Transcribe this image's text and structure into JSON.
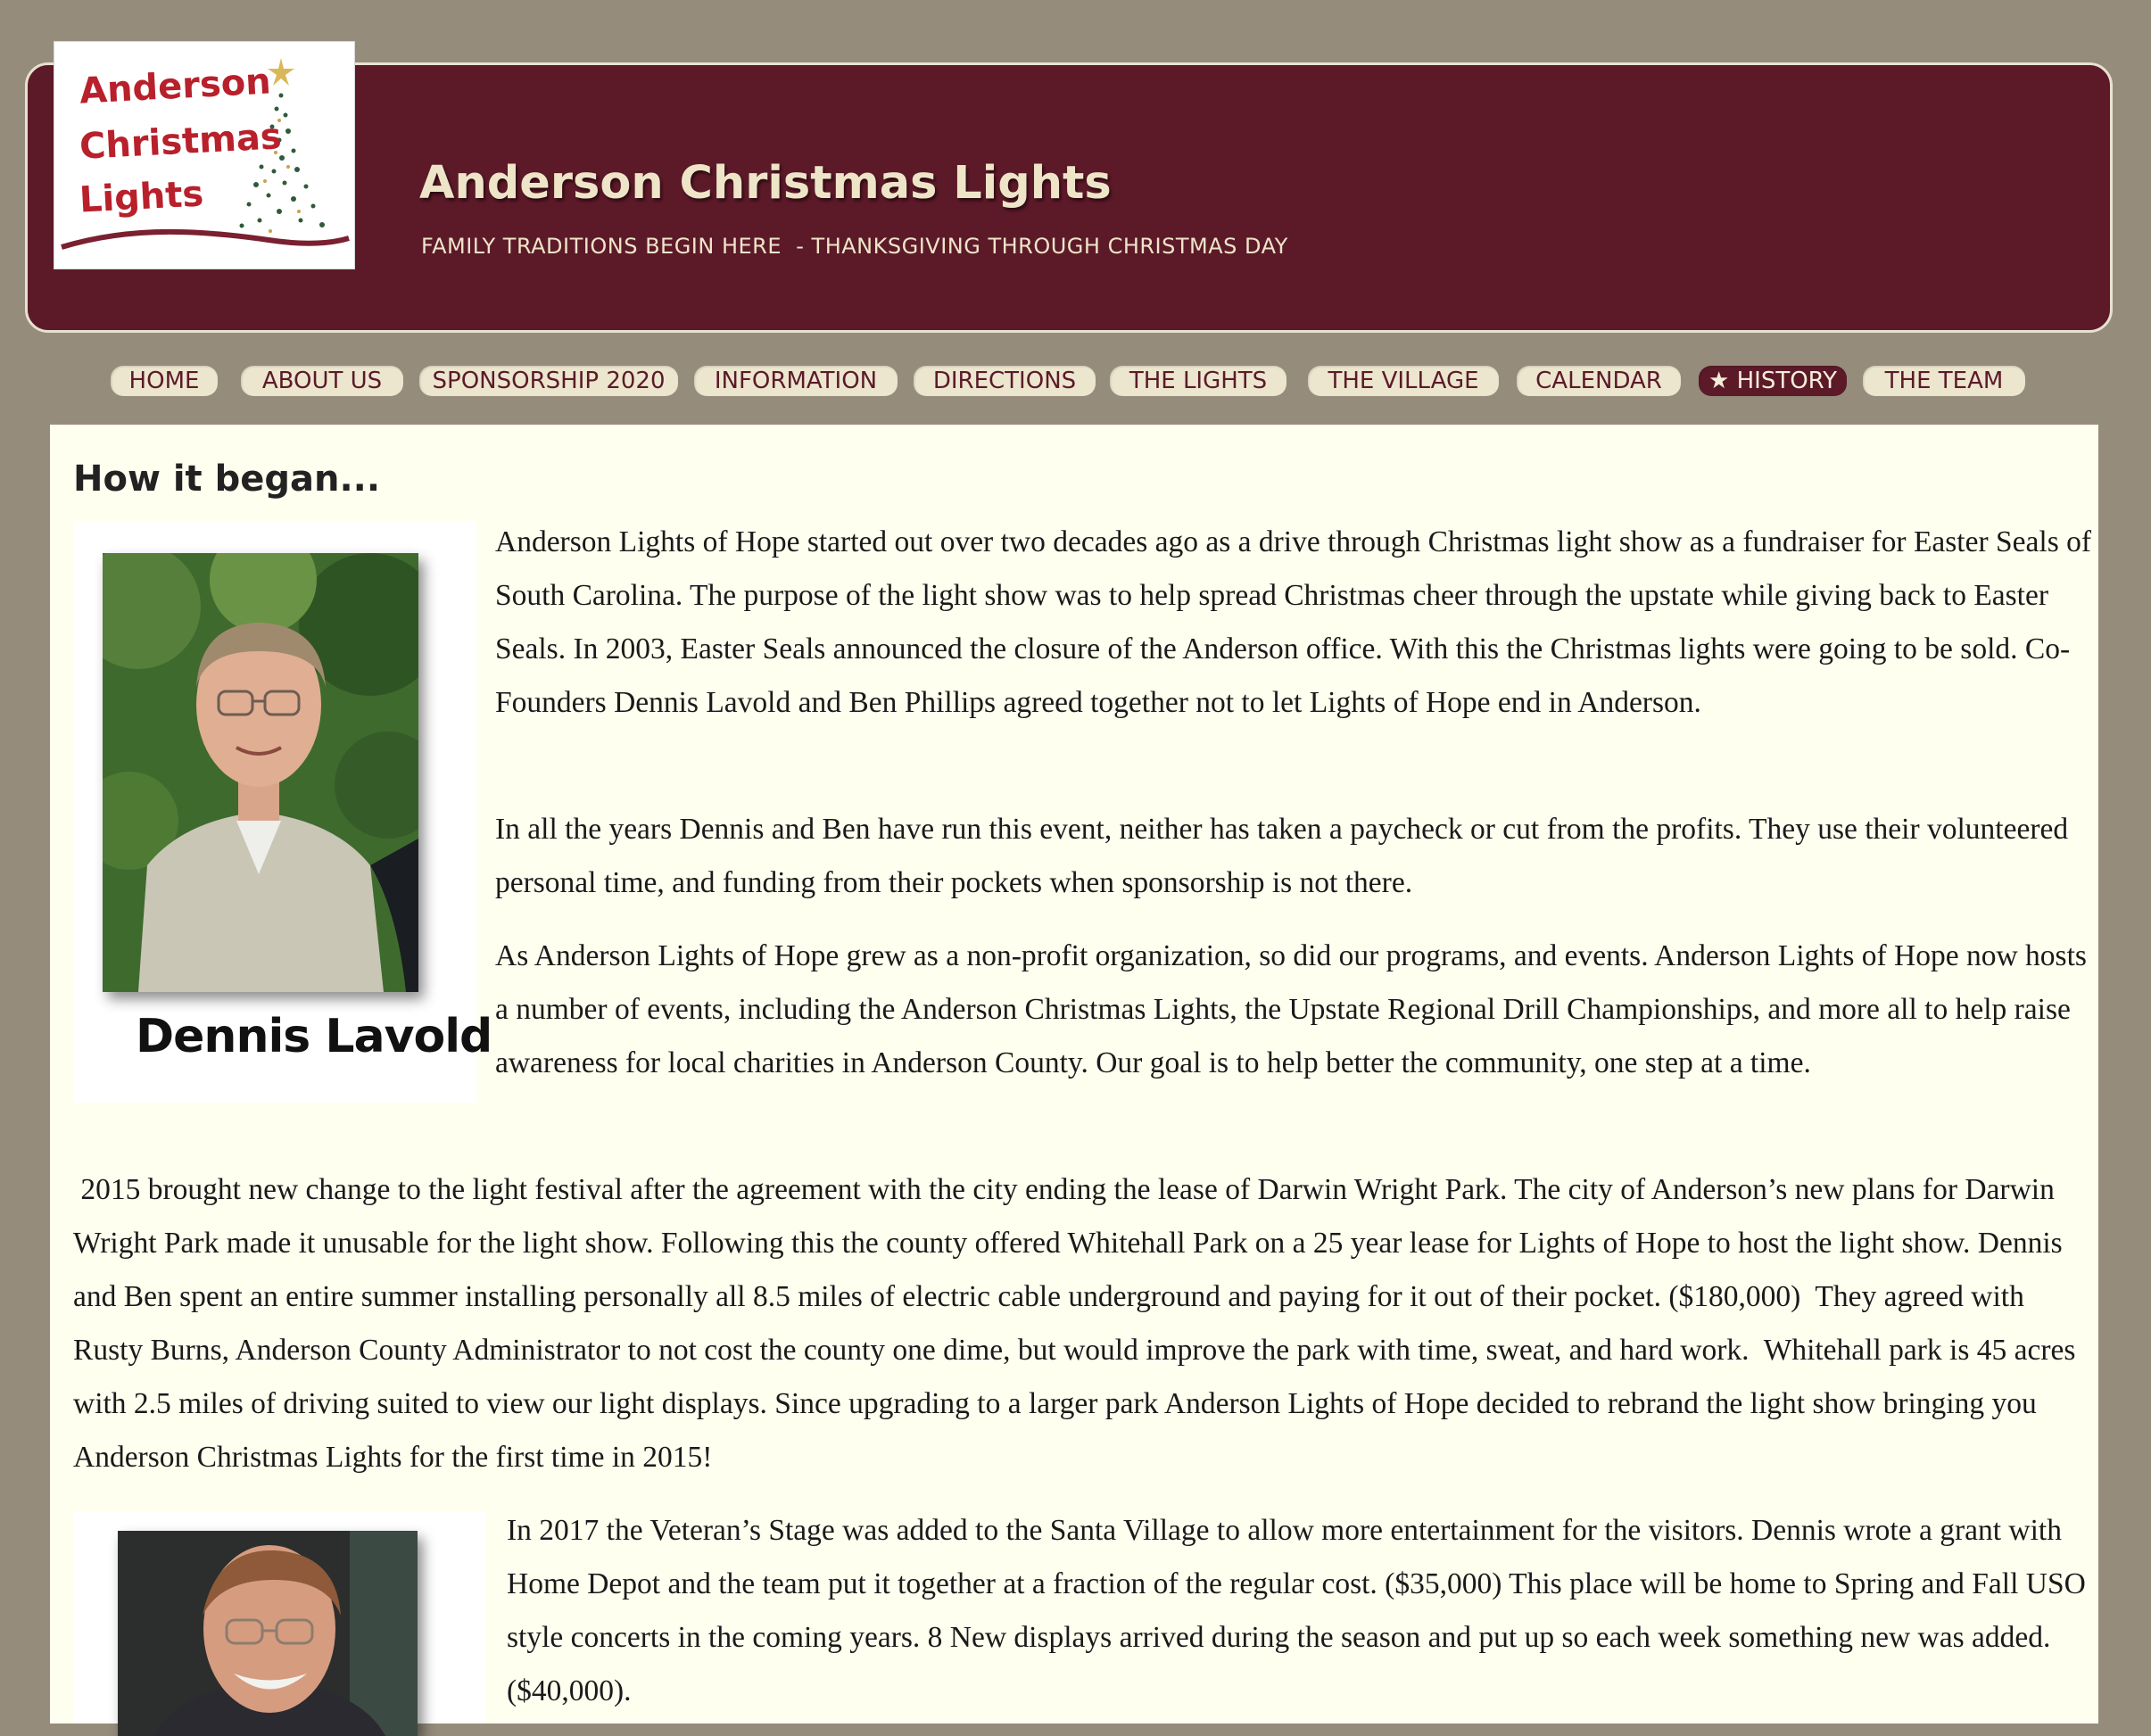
{
  "logo": {
    "line1": "Anderson",
    "line2": "Christmas",
    "line3": "Lights"
  },
  "header": {
    "title": "Anderson Christmas Lights",
    "tagline": "FAMILY TRADITIONS BEGIN HERE  - THANKSGIVING THROUGH CHRISTMAS DAY"
  },
  "nav": {
    "items": [
      {
        "label": "HOME"
      },
      {
        "label": "ABOUT US"
      },
      {
        "label": "SPONSORSHIP 2020"
      },
      {
        "label": "INFORMATION"
      },
      {
        "label": "DIRECTIONS"
      },
      {
        "label": "THE LIGHTS"
      },
      {
        "label": "THE VILLAGE"
      },
      {
        "label": "CALENDAR"
      },
      {
        "label": "★ HISTORY",
        "active": true
      },
      {
        "label": "THE TEAM"
      }
    ]
  },
  "main": {
    "heading": "How it began...",
    "photo1_caption": "Dennis Lavold",
    "paragraphs": [
      "Anderson Lights of Hope started out over two decades ago as a drive through Christmas light show as a fundraiser for Easter Seals of South Carolina. The purpose of the light show was to help spread Christmas cheer through the upstate while giving back to Easter Seals. In 2003, Easter Seals announced the closure of the Anderson office. With this the Christmas lights were going to be sold.  Co-Founders Dennis Lavold and Ben Phillips agreed together not to let Lights of Hope end in Anderson.",
      "In all the years Dennis and Ben have run this event, neither has taken a paycheck or cut from the profits. They use their volunteered personal time, and funding from their pockets when sponsorship is not there.",
      "As Anderson Lights of Hope grew as a non-profit organization, so did our programs, and events. Anderson Lights of Hope now hosts a number of events, including the Anderson Christmas Lights, the Upstate Regional Drill Championships, and more all to help raise awareness for local charities in Anderson County. Our goal is to help better the community, one step at a time.",
      " 2015 brought new change to the light festival after the agreement with the city ending the lease of Darwin Wright Park. The city of Anderson’s new plans for Darwin Wright Park made it unusable for the light show. Following this the county offered Whitehall Park on a 25 year lease for Lights of Hope to host the light show. Dennis and Ben spent an entire summer installing personally all 8.5 miles of electric cable underground and paying for it out of their pocket. ($180,000)  They agreed with Rusty Burns, Anderson County Administrator to not cost the county one dime, but would improve the park with time, sweat, and hard work.  Whitehall park is 45 acres with 2.5 miles of driving suited to view our light displays. Since upgrading to a larger park Anderson Lights of Hope decided to rebrand the light show bringing you Anderson Christmas Lights for the first time in 2015!",
      "In 2017 the Veteran’s Stage was added to the Santa Village to allow more entertainment for the visitors. Dennis wrote a grant with Home Depot and the team put it together at a fraction of the regular cost. ($35,000) This place will be home to Spring and Fall USO style concerts in the coming years. 8 New displays arrived during the season and put up so each week something new was added. ($40,000)."
    ]
  },
  "colors": {
    "page_bg": "#958c7c",
    "header_bg": "#5c1a29",
    "header_text": "#eee5c8",
    "nav_bg": "#ece6cf",
    "nav_active_bg": "#5c1a29",
    "content_bg": "#fffff0"
  }
}
